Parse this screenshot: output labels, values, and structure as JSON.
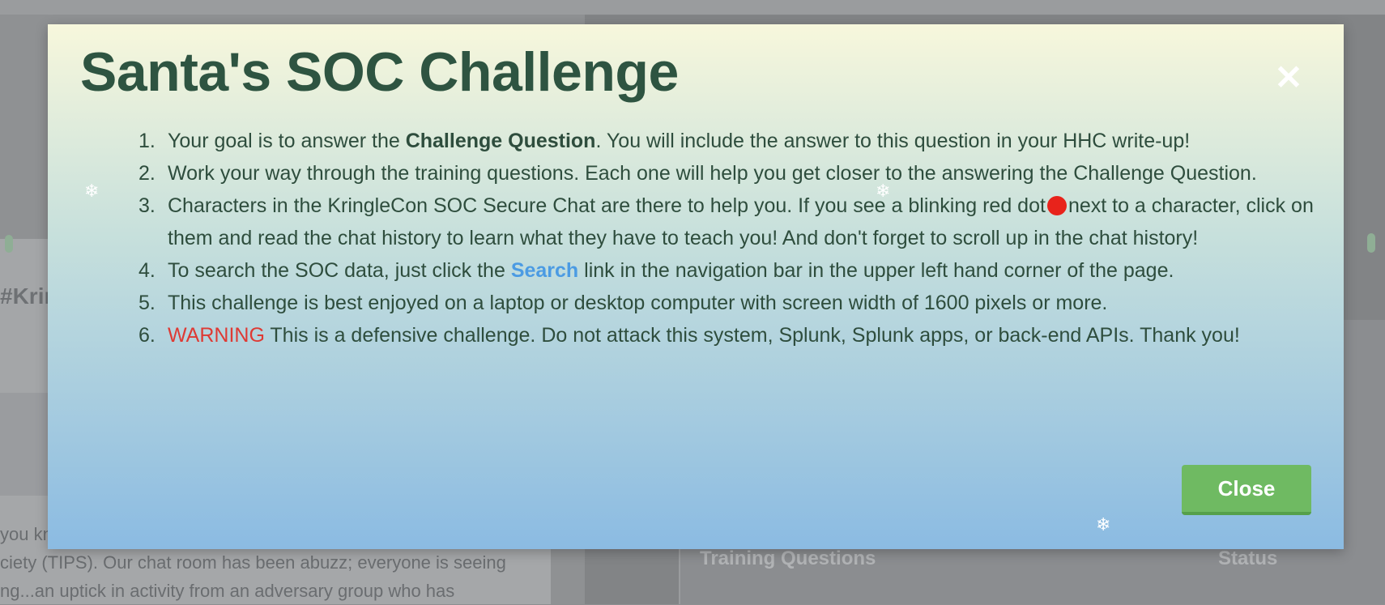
{
  "background": {
    "chat_fragment": "#Krin",
    "chat_lines": [
      "you kn",
      "ciety (TIPS). Our chat room has been abuzz; everyone is seeing",
      "ng...an uptick in activity from an adversary group who has"
    ],
    "training_header": "Training Questions",
    "status_header": "Status"
  },
  "modal": {
    "title": "Santa's SOC Challenge",
    "close_icon": "close-icon",
    "close_button_label": "Close",
    "rules": {
      "r1": {
        "num": "1.",
        "before": "Your goal is to answer the ",
        "bold": "Challenge Question",
        "after": ". You will include the answer to this question in your HHC write-up!"
      },
      "r2": {
        "num": "2.",
        "text": "Work your way through the training questions. Each one will help you get closer to the answering the Challenge Question."
      },
      "r3": {
        "num": "3.",
        "before": "Characters in the KringleCon SOC Secure Chat are there to help you. If you see a blinking red dot",
        "after": "next to a character, click on them and read the chat history to learn what they have to teach you! And don't forget to scroll up in the chat history!"
      },
      "r4": {
        "num": "4.",
        "before": "To search the SOC data, just click the ",
        "link": "Search",
        "after": " link in the navigation bar in the upper left hand corner of the page."
      },
      "r5": {
        "num": "5.",
        "text": "This challenge is best enjoyed on a laptop or desktop computer with screen width of 1600 pixels or more."
      },
      "r6": {
        "num": "6.",
        "warning": "WARNING",
        "after": " This is a defensive challenge. Do not attack this system, Splunk, Splunk apps, or back-end APIs. Thank you!"
      }
    }
  },
  "colors": {
    "title": "#2e5441",
    "warning": "#de3a34",
    "link": "#4b9be3",
    "close_button": "#6fba62",
    "red_dot": "#e8231b"
  },
  "snowflake_glyph": "❄"
}
